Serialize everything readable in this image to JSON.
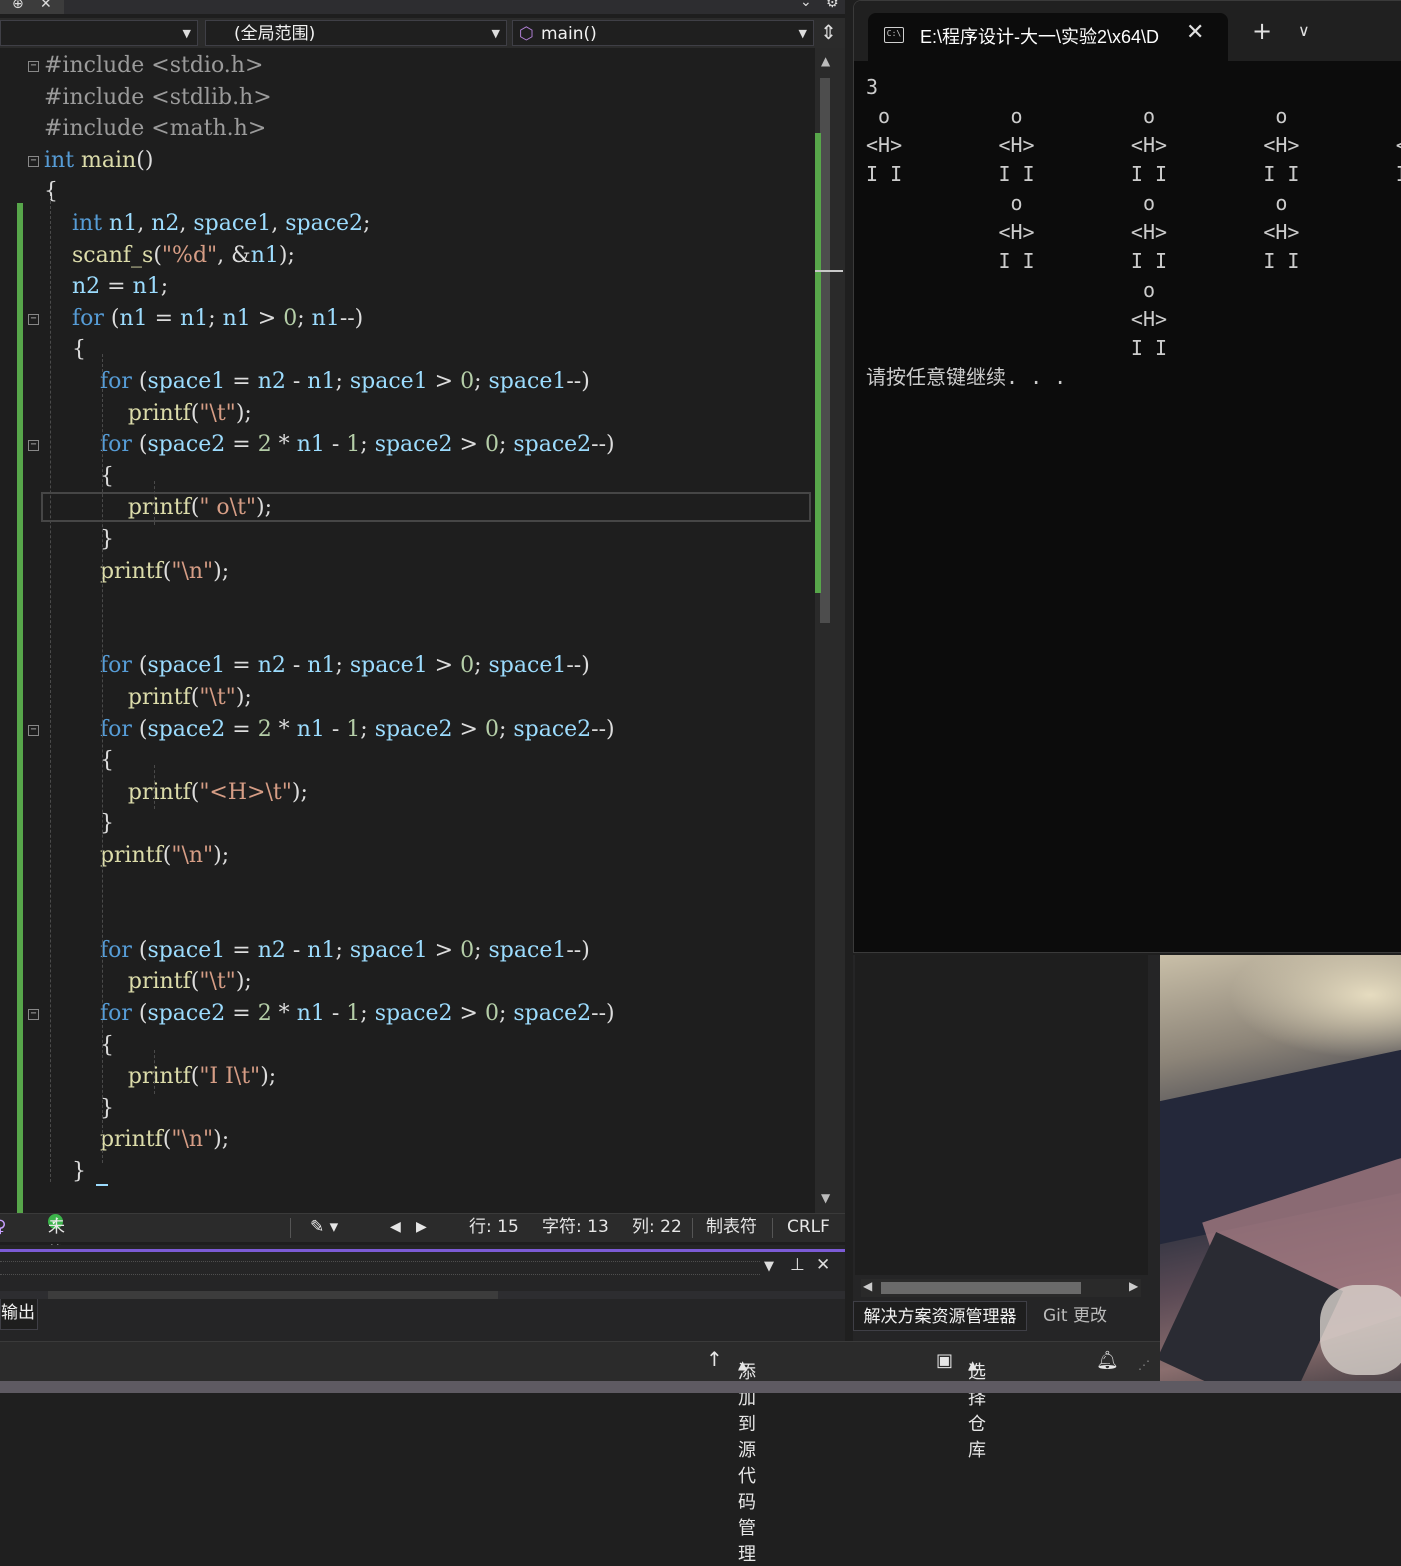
{
  "editor": {
    "nav": {
      "scope": "(全局范围)",
      "member": "main()"
    },
    "code_lines": [
      [
        [
          "pp",
          "#include <stdio.h>"
        ]
      ],
      [
        [
          "pp",
          "#include <stdlib.h>"
        ]
      ],
      [
        [
          "pp",
          "#include <math.h>"
        ]
      ],
      [
        [
          "kw",
          "int"
        ],
        [
          "t",
          " "
        ],
        [
          "fn",
          "main"
        ],
        [
          "t",
          "()"
        ]
      ],
      [
        [
          "t",
          "{"
        ]
      ],
      [
        [
          "t",
          "    "
        ],
        [
          "kw",
          "int"
        ],
        [
          "t",
          " "
        ],
        [
          "var",
          "n1"
        ],
        [
          "t",
          ", "
        ],
        [
          "var",
          "n2"
        ],
        [
          "t",
          ", "
        ],
        [
          "var",
          "space1"
        ],
        [
          "t",
          ", "
        ],
        [
          "var",
          "space2"
        ],
        [
          "t",
          ";"
        ]
      ],
      [
        [
          "t",
          "    "
        ],
        [
          "fn",
          "scanf_s"
        ],
        [
          "t",
          "("
        ],
        [
          "str",
          "\"%d\""
        ],
        [
          "t",
          ", &"
        ],
        [
          "var",
          "n1"
        ],
        [
          "t",
          ");"
        ]
      ],
      [
        [
          "t",
          "    "
        ],
        [
          "var",
          "n2"
        ],
        [
          "t",
          " = "
        ],
        [
          "var",
          "n1"
        ],
        [
          "t",
          ";"
        ]
      ],
      [
        [
          "t",
          "    "
        ],
        [
          "kw",
          "for"
        ],
        [
          "t",
          " ("
        ],
        [
          "var",
          "n1"
        ],
        [
          "t",
          " = "
        ],
        [
          "var",
          "n1"
        ],
        [
          "t",
          "; "
        ],
        [
          "var",
          "n1"
        ],
        [
          "t",
          " > "
        ],
        [
          "num",
          "0"
        ],
        [
          "t",
          "; "
        ],
        [
          "var",
          "n1"
        ],
        [
          "t",
          "--)"
        ]
      ],
      [
        [
          "t",
          "    {"
        ]
      ],
      [
        [
          "t",
          "        "
        ],
        [
          "kw",
          "for"
        ],
        [
          "t",
          " ("
        ],
        [
          "var",
          "space1"
        ],
        [
          "t",
          " = "
        ],
        [
          "var",
          "n2"
        ],
        [
          "t",
          " - "
        ],
        [
          "var",
          "n1"
        ],
        [
          "t",
          "; "
        ],
        [
          "var",
          "space1"
        ],
        [
          "t",
          " > "
        ],
        [
          "num",
          "0"
        ],
        [
          "t",
          "; "
        ],
        [
          "var",
          "space1"
        ],
        [
          "t",
          "--)"
        ]
      ],
      [
        [
          "t",
          "            "
        ],
        [
          "fn",
          "printf"
        ],
        [
          "t",
          "("
        ],
        [
          "str",
          "\"\\t\""
        ],
        [
          "t",
          ");"
        ]
      ],
      [
        [
          "t",
          "        "
        ],
        [
          "kw",
          "for"
        ],
        [
          "t",
          " ("
        ],
        [
          "var",
          "space2"
        ],
        [
          "t",
          " = "
        ],
        [
          "num",
          "2"
        ],
        [
          "t",
          " * "
        ],
        [
          "var",
          "n1"
        ],
        [
          "t",
          " - "
        ],
        [
          "num",
          "1"
        ],
        [
          "t",
          "; "
        ],
        [
          "var",
          "space2"
        ],
        [
          "t",
          " > "
        ],
        [
          "num",
          "0"
        ],
        [
          "t",
          "; "
        ],
        [
          "var",
          "space2"
        ],
        [
          "t",
          "--)"
        ]
      ],
      [
        [
          "t",
          "        {"
        ]
      ],
      [
        [
          "t",
          "            "
        ],
        [
          "fn",
          "printf"
        ],
        [
          "t",
          "("
        ],
        [
          "str",
          "\" o\\t\""
        ],
        [
          "t",
          ");"
        ]
      ],
      [
        [
          "t",
          "        }"
        ]
      ],
      [
        [
          "t",
          "        "
        ],
        [
          "fn",
          "printf"
        ],
        [
          "t",
          "("
        ],
        [
          "str",
          "\"\\n\""
        ],
        [
          "t",
          ");"
        ]
      ],
      [],
      [],
      [
        [
          "t",
          "        "
        ],
        [
          "kw",
          "for"
        ],
        [
          "t",
          " ("
        ],
        [
          "var",
          "space1"
        ],
        [
          "t",
          " = "
        ],
        [
          "var",
          "n2"
        ],
        [
          "t",
          " - "
        ],
        [
          "var",
          "n1"
        ],
        [
          "t",
          "; "
        ],
        [
          "var",
          "space1"
        ],
        [
          "t",
          " > "
        ],
        [
          "num",
          "0"
        ],
        [
          "t",
          "; "
        ],
        [
          "var",
          "space1"
        ],
        [
          "t",
          "--)"
        ]
      ],
      [
        [
          "t",
          "            "
        ],
        [
          "fn",
          "printf"
        ],
        [
          "t",
          "("
        ],
        [
          "str",
          "\"\\t\""
        ],
        [
          "t",
          ");"
        ]
      ],
      [
        [
          "t",
          "        "
        ],
        [
          "kw",
          "for"
        ],
        [
          "t",
          " ("
        ],
        [
          "var",
          "space2"
        ],
        [
          "t",
          " = "
        ],
        [
          "num",
          "2"
        ],
        [
          "t",
          " * "
        ],
        [
          "var",
          "n1"
        ],
        [
          "t",
          " - "
        ],
        [
          "num",
          "1"
        ],
        [
          "t",
          "; "
        ],
        [
          "var",
          "space2"
        ],
        [
          "t",
          " > "
        ],
        [
          "num",
          "0"
        ],
        [
          "t",
          "; "
        ],
        [
          "var",
          "space2"
        ],
        [
          "t",
          "--)"
        ]
      ],
      [
        [
          "t",
          "        {"
        ]
      ],
      [
        [
          "t",
          "            "
        ],
        [
          "fn",
          "printf"
        ],
        [
          "t",
          "("
        ],
        [
          "str",
          "\"<H>\\t\""
        ],
        [
          "t",
          ");"
        ]
      ],
      [
        [
          "t",
          "        }"
        ]
      ],
      [
        [
          "t",
          "        "
        ],
        [
          "fn",
          "printf"
        ],
        [
          "t",
          "("
        ],
        [
          "str",
          "\"\\n\""
        ],
        [
          "t",
          ");"
        ]
      ],
      [],
      [],
      [
        [
          "t",
          "        "
        ],
        [
          "kw",
          "for"
        ],
        [
          "t",
          " ("
        ],
        [
          "var",
          "space1"
        ],
        [
          "t",
          " = "
        ],
        [
          "var",
          "n2"
        ],
        [
          "t",
          " - "
        ],
        [
          "var",
          "n1"
        ],
        [
          "t",
          "; "
        ],
        [
          "var",
          "space1"
        ],
        [
          "t",
          " > "
        ],
        [
          "num",
          "0"
        ],
        [
          "t",
          "; "
        ],
        [
          "var",
          "space1"
        ],
        [
          "t",
          "--)"
        ]
      ],
      [
        [
          "t",
          "            "
        ],
        [
          "fn",
          "printf"
        ],
        [
          "t",
          "("
        ],
        [
          "str",
          "\"\\t\""
        ],
        [
          "t",
          ");"
        ]
      ],
      [
        [
          "t",
          "        "
        ],
        [
          "kw",
          "for"
        ],
        [
          "t",
          " ("
        ],
        [
          "var",
          "space2"
        ],
        [
          "t",
          " = "
        ],
        [
          "num",
          "2"
        ],
        [
          "t",
          " * "
        ],
        [
          "var",
          "n1"
        ],
        [
          "t",
          " - "
        ],
        [
          "num",
          "1"
        ],
        [
          "t",
          "; "
        ],
        [
          "var",
          "space2"
        ],
        [
          "t",
          " > "
        ],
        [
          "num",
          "0"
        ],
        [
          "t",
          "; "
        ],
        [
          "var",
          "space2"
        ],
        [
          "t",
          "--)"
        ]
      ],
      [
        [
          "t",
          "        {"
        ]
      ],
      [
        [
          "t",
          "            "
        ],
        [
          "fn",
          "printf"
        ],
        [
          "t",
          "("
        ],
        [
          "str",
          "\"I I\\t\""
        ],
        [
          "t",
          ");"
        ]
      ],
      [
        [
          "t",
          "        }"
        ]
      ],
      [
        [
          "t",
          "        "
        ],
        [
          "fn",
          "printf"
        ],
        [
          "t",
          "("
        ],
        [
          "str",
          "\"\\n\""
        ],
        [
          "t",
          ");"
        ]
      ],
      [
        [
          "t",
          "    }"
        ]
      ]
    ],
    "status": {
      "issues": "未找到相关问题",
      "line": "行: 15",
      "char": "字符: 13",
      "col": "列: 22",
      "indent": "制表符",
      "eol": "CRLF"
    }
  },
  "output_panel": {
    "tab_label": "输出"
  },
  "bottom_status": {
    "source_control": "添加到源代码管理",
    "repo": "选择仓库"
  },
  "solution_tabs": {
    "explorer": "解决方案资源管理器",
    "git": "Git 更改"
  },
  "console": {
    "tab_title": "E:\\程序设计-大一\\实验2\\x64\\D",
    "lines": [
      "3",
      " o          o          o          o          o",
      "<H>        <H>        <H>        <H>        <H>",
      "I I        I I        I I        I I        I I",
      "            o          o          o",
      "           <H>        <H>        <H>",
      "           I I        I I        I I",
      "                       o",
      "                      <H>",
      "                      I I",
      "请按任意键继续. . ."
    ]
  },
  "colors": {
    "accent": "#7c5bd6",
    "change_bar": "#57a64a",
    "console_bg": "#0c0c0c",
    "editor_bg": "#1e1e1e"
  }
}
